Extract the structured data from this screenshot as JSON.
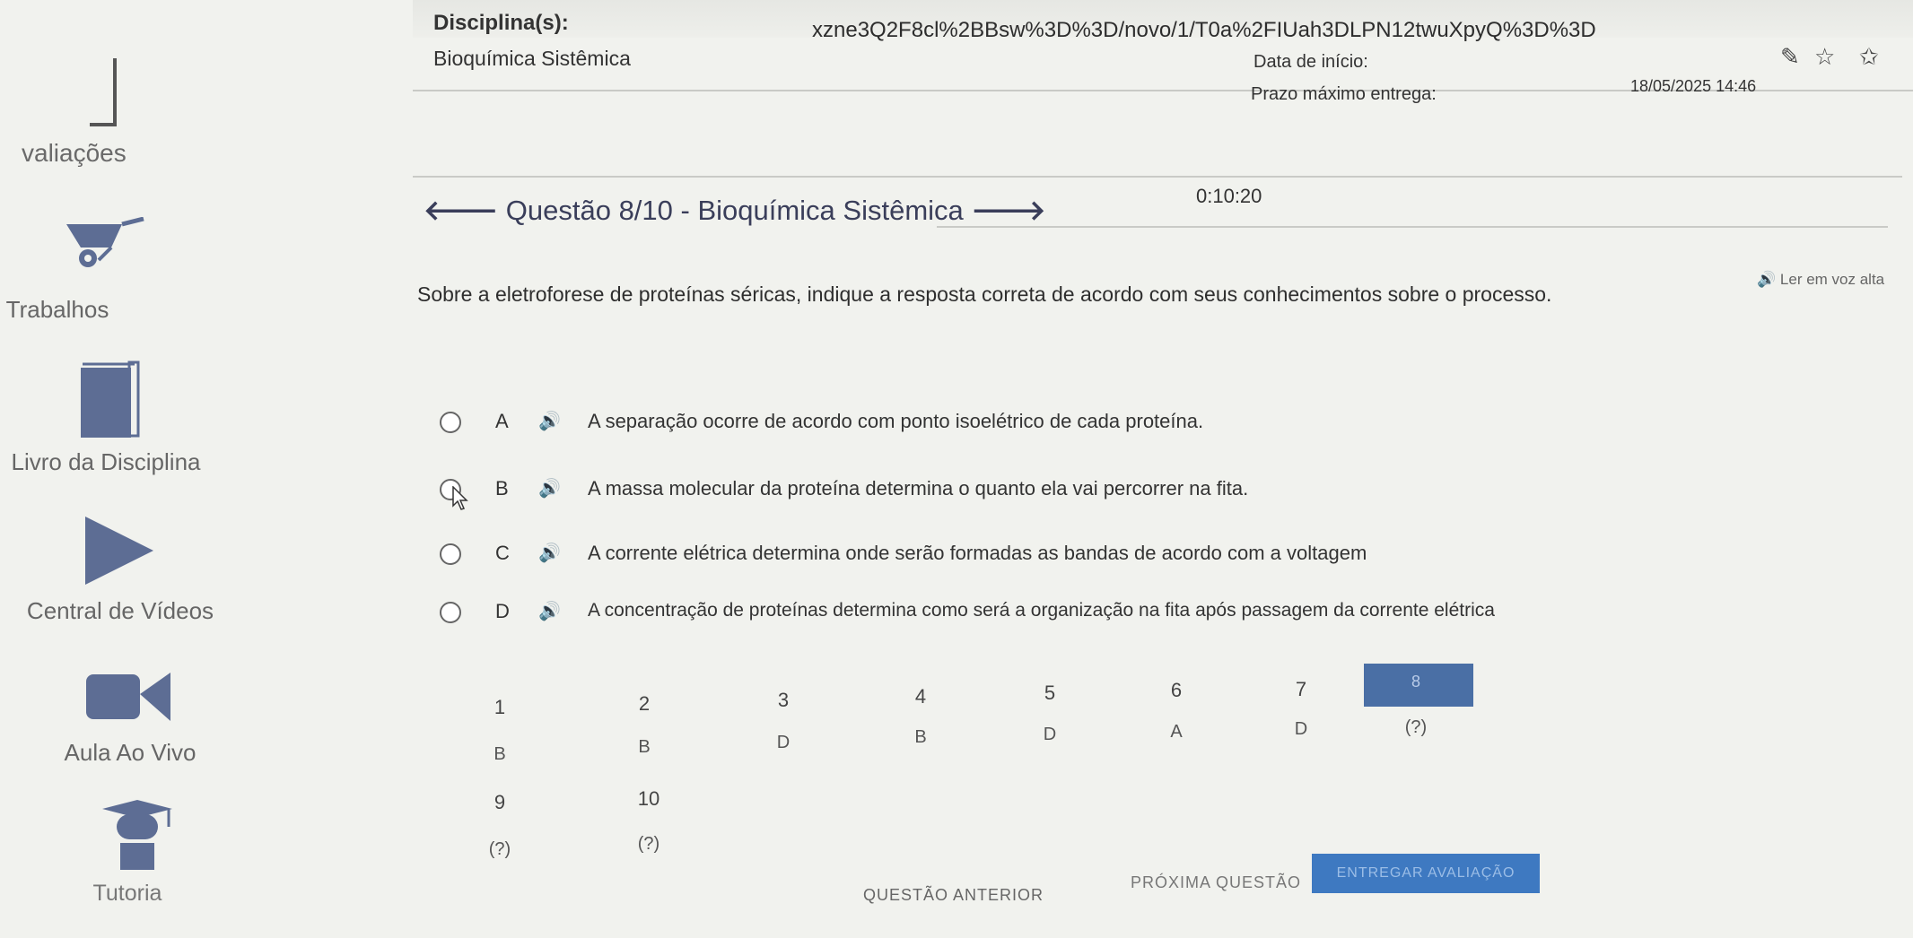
{
  "browser": {
    "url_fragment": "xzne3Q2F8cl%2BBsw%3D%3D/novo/1/T0a%2FIUah3DLPN12twuXpyQ%3D%3D"
  },
  "sidebar": {
    "partial_label": "valiações",
    "items": [
      {
        "label": "Trabalhos",
        "icon": "wheelbarrow-icon"
      },
      {
        "label": "Livro da Disciplina",
        "icon": "book-icon"
      },
      {
        "label": "Central de Vídeos",
        "icon": "play-icon"
      },
      {
        "label": "Aula Ao Vivo",
        "icon": "video-camera-icon"
      },
      {
        "label": "Tutoria",
        "icon": "graduate-icon"
      }
    ]
  },
  "header": {
    "discipline_label": "Disciplina(s):",
    "discipline_value": "Bioquímica Sistêmica",
    "start_label": "Data de início:",
    "start_value": "18/05/2025 14:46",
    "deadline_label": "Prazo máximo entrega:"
  },
  "question": {
    "timer": "0:10:20",
    "title": "Questão 8/10 - Bioquímica Sistêmica",
    "text": "Sobre a eletroforese de proteínas séricas, indique a resposta correta de acordo com seus conhecimentos sobre o processo.",
    "read_aloud": "Ler em voz alta",
    "options": [
      {
        "letter": "A",
        "text": "A separação ocorre de acordo com ponto isoelétrico de cada proteína."
      },
      {
        "letter": "B",
        "text": "A massa molecular da proteína determina o quanto ela vai percorrer na fita."
      },
      {
        "letter": "C",
        "text": "A corrente elétrica determina onde serão formadas as bandas de acordo com a voltagem"
      },
      {
        "letter": "D",
        "text": "A concentração de proteínas determina como será a organização na fita após passagem da corrente elétrica"
      }
    ]
  },
  "navigation": {
    "cells": [
      {
        "num": "1",
        "answer": "B"
      },
      {
        "num": "2",
        "answer": "B"
      },
      {
        "num": "3",
        "answer": "D"
      },
      {
        "num": "4",
        "answer": "B"
      },
      {
        "num": "5",
        "answer": "D"
      },
      {
        "num": "6",
        "answer": "A"
      },
      {
        "num": "7",
        "answer": "D"
      },
      {
        "num": "8",
        "answer": "(?)"
      },
      {
        "num": "9",
        "answer": "(?)"
      },
      {
        "num": "10",
        "answer": "(?)"
      }
    ],
    "current": "8"
  },
  "buttons": {
    "previous": "QUESTÃO ANTERIOR",
    "next": "PRÓXIMA QUESTÃO",
    "submit": "ENTREGAR AVALIAÇÃO"
  },
  "colors": {
    "accent": "#4a6fa5",
    "submit": "#3e79c1",
    "icon": "#5d6d94"
  }
}
